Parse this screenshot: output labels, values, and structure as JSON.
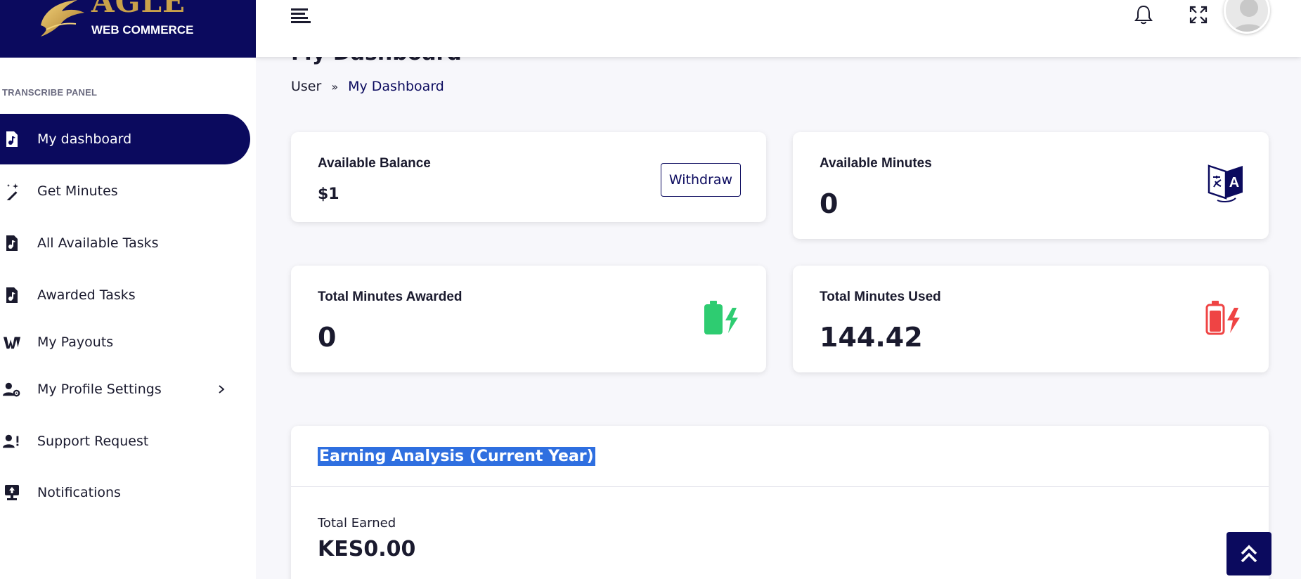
{
  "brand": {
    "word": "AGLE",
    "subtitle": "WEB COMMERCE",
    "accent_color": "#c9a14a",
    "primary_color": "#0b0a5e"
  },
  "sidebar": {
    "section_label": "TRANSCRIBE PANEL",
    "items": [
      {
        "label": "My dashboard",
        "icon": "audio-file-icon",
        "active": true
      },
      {
        "label": "Get Minutes",
        "icon": "magic-wand-icon",
        "active": false
      },
      {
        "label": "All Available Tasks",
        "icon": "audio-file-icon",
        "active": false
      },
      {
        "label": "Awarded Tasks",
        "icon": "audio-file-icon",
        "active": false
      },
      {
        "label": "My Payouts",
        "icon": "wallet-icon",
        "active": false
      },
      {
        "label": "My Profile Settings",
        "icon": "user-gear-icon",
        "active": false,
        "has_submenu": true
      },
      {
        "label": "Support Request",
        "icon": "user-alert-icon",
        "active": false
      },
      {
        "label": "Notifications",
        "icon": "upload-screen-icon",
        "active": false
      }
    ]
  },
  "topbar": {
    "icons": [
      "menu-icon",
      "bell-icon",
      "expand-icon",
      "avatar"
    ]
  },
  "main": {
    "title": "My Dashboard",
    "breadcrumb": {
      "root": "User",
      "separator": "»",
      "current": "My Dashboard"
    },
    "cards": {
      "balance": {
        "title": "Available Balance",
        "value": "$1",
        "button": "Withdraw"
      },
      "minutes": {
        "title": "Available Minutes",
        "value": "0",
        "icon": "translate-icon"
      },
      "awarded": {
        "title": "Total Minutes Awarded",
        "value": "0",
        "icon": "battery-charging-icon",
        "icon_color": "#2ecc71"
      },
      "used": {
        "title": "Total Minutes Used",
        "value": "144.42",
        "icon": "battery-low-icon",
        "icon_color": "#ef4444"
      }
    },
    "earning": {
      "title": "Earning Analysis (Current Year)",
      "total_label": "Total Earned",
      "total_value": "KES0.00"
    }
  }
}
